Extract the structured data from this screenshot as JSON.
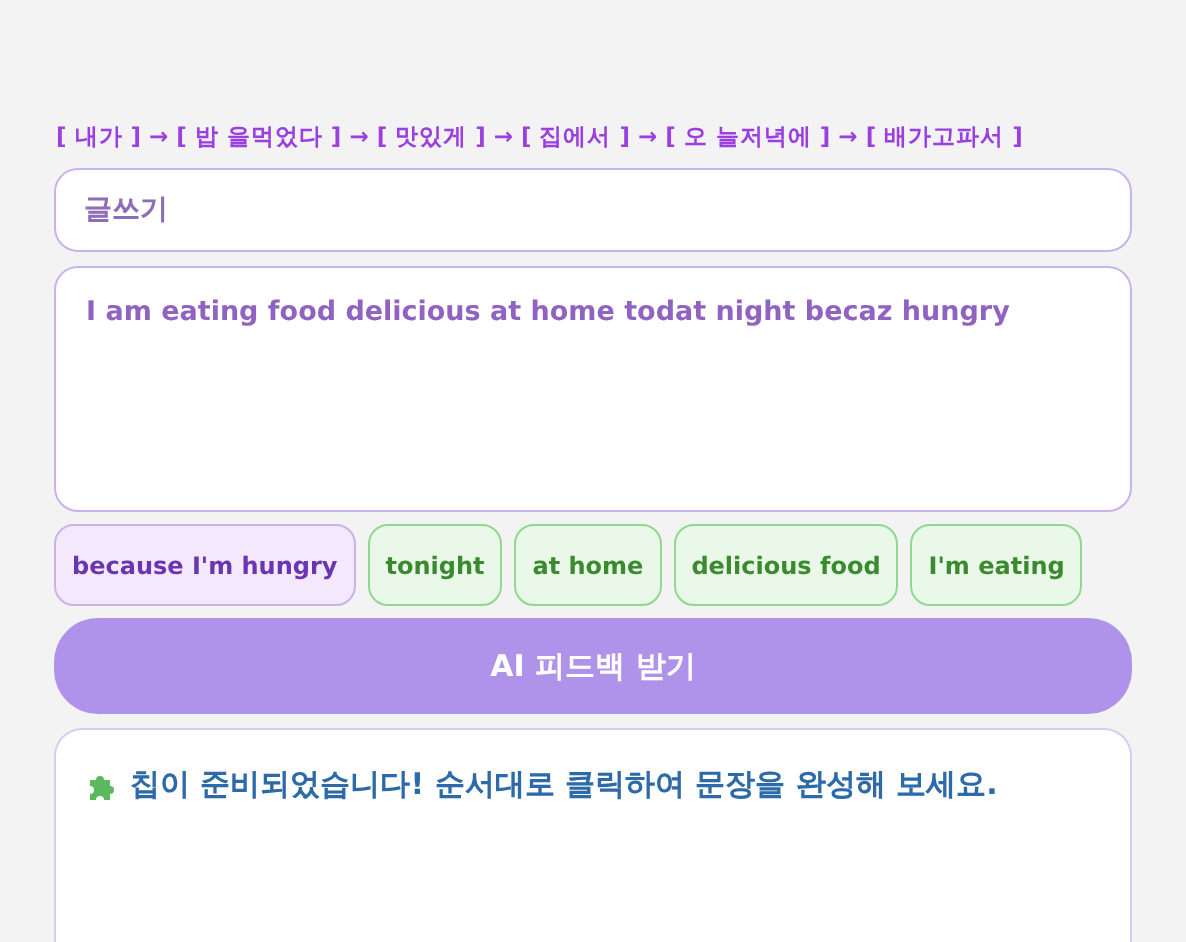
{
  "sequence_hint": "[ 내가 ] → [ 밥 을먹었다 ] → [ 맛있게 ] → [ 집에서 ] → [ 오 늘저녁에 ] → [ 배가고파서 ]",
  "title_field": {
    "value": "글쓰기"
  },
  "answer_field": {
    "value": "I am eating food delicious at home todat night becaz hungry"
  },
  "chips": [
    {
      "label": "because I'm hungry",
      "selected": true
    },
    {
      "label": "tonight",
      "selected": false
    },
    {
      "label": "at home",
      "selected": false
    },
    {
      "label": "delicious food",
      "selected": false
    },
    {
      "label": "I'm eating",
      "selected": false
    }
  ],
  "feedback_button": "AI 피드백 받기",
  "result": {
    "message": "칩이 준비되었습니다! 순서대로 클릭하여 문장을 완성해 보세요."
  }
}
